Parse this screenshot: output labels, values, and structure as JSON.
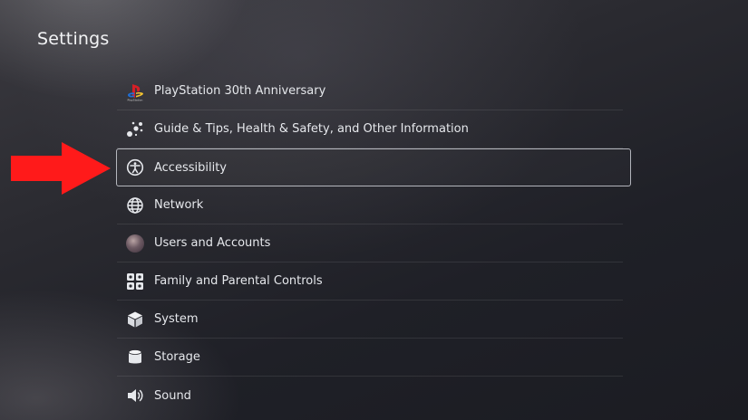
{
  "header": {
    "title": "Settings"
  },
  "menu": {
    "items": [
      {
        "label": "PlayStation 30th Anniversary",
        "icon": "playstation-logo-icon"
      },
      {
        "label": "Guide & Tips, Health & Safety, and Other Information",
        "icon": "guide-tips-icon"
      },
      {
        "label": "Accessibility",
        "icon": "accessibility-icon",
        "selected": true
      },
      {
        "label": "Network",
        "icon": "globe-icon"
      },
      {
        "label": "Users and Accounts",
        "icon": "user-avatar-icon"
      },
      {
        "label": "Family and Parental Controls",
        "icon": "family-controls-icon"
      },
      {
        "label": "System",
        "icon": "cube-icon"
      },
      {
        "label": "Storage",
        "icon": "storage-cylinder-icon"
      },
      {
        "label": "Sound",
        "icon": "speaker-icon"
      }
    ]
  },
  "annotation": {
    "arrow_color": "#ff1a1a"
  },
  "colors": {
    "background": "#24252b",
    "selected_border": "#e1e4eb",
    "text": "#e6e8ec"
  }
}
